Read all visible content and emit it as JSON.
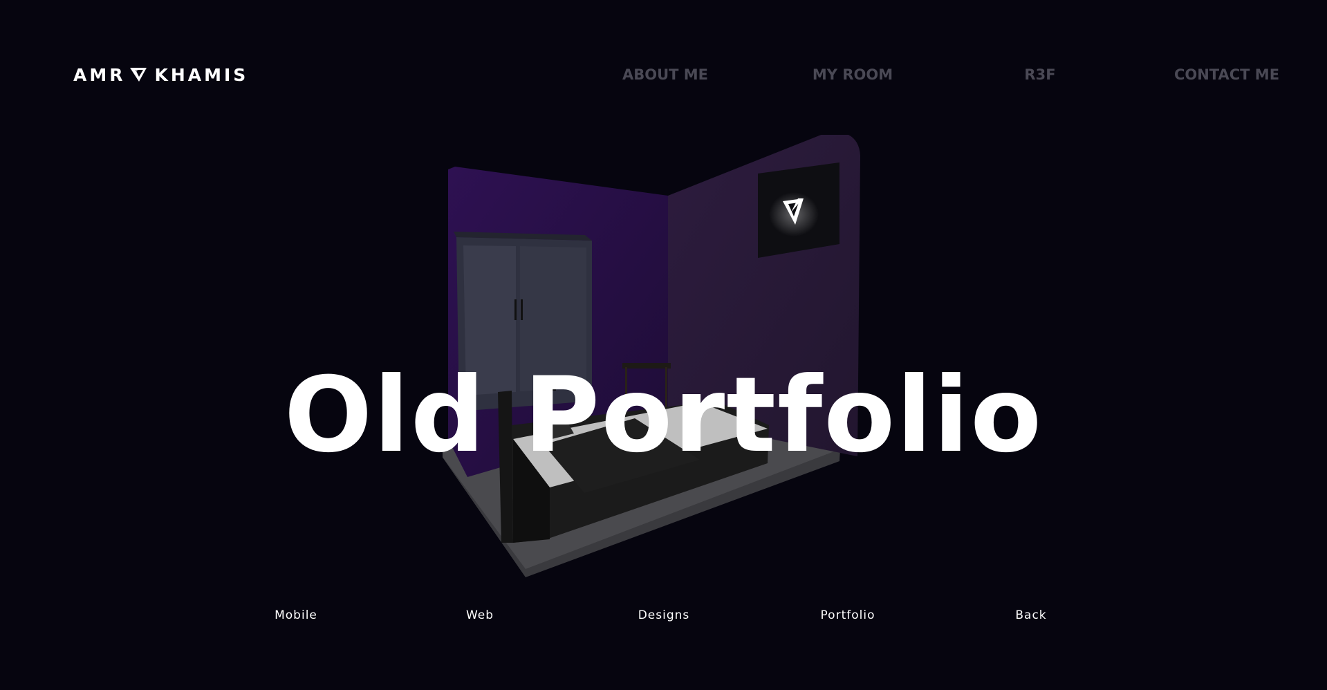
{
  "header": {
    "logo_left": "AMR",
    "logo_right": "KHAMIS",
    "nav": [
      {
        "label": "ABOUT ME"
      },
      {
        "label": "MY ROOM"
      },
      {
        "label": "R3F"
      },
      {
        "label": "CONTACT ME"
      }
    ]
  },
  "hero": {
    "title": "Old Portfolio"
  },
  "links": [
    {
      "label": "Mobile"
    },
    {
      "label": "Web"
    },
    {
      "label": "Designs"
    },
    {
      "label": "Portfolio"
    },
    {
      "label": "Back"
    }
  ],
  "colors": {
    "background": "#06050f",
    "nav_text": "#4a4955",
    "text": "#ffffff",
    "wall_left": "#2a1248",
    "wall_right": "#2b1a3a"
  },
  "icons": {
    "logo_mark": "k-chevron-logo-icon",
    "tv_logo": "k-chevron-logo-icon"
  }
}
